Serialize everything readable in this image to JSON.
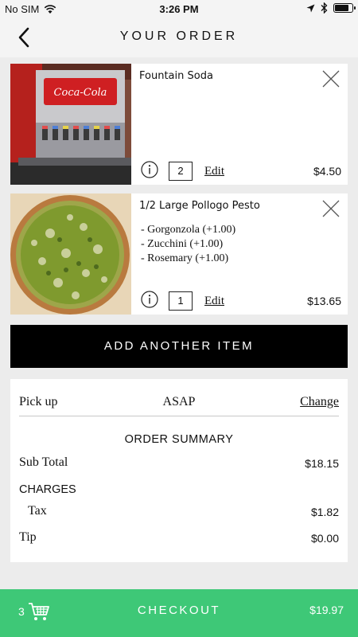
{
  "status_bar": {
    "carrier": "No SIM",
    "time": "3:26 PM",
    "battery_level": 0.9
  },
  "nav": {
    "title": "YOUR ORDER",
    "back_icon": "chevron-left-icon"
  },
  "items": [
    {
      "name": "Fountain Soda",
      "modifiers": [],
      "quantity": "2",
      "edit_label": "Edit",
      "price": "$4.50",
      "image": "fountain-soda-image"
    },
    {
      "name": "1/2 Large Pollogo Pesto",
      "modifiers": [
        "- Gorgonzola (+1.00)",
        "- Zucchini (+1.00)",
        "- Rosemary (+1.00)"
      ],
      "quantity": "1",
      "edit_label": "Edit",
      "price": "$13.65",
      "image": "pesto-pizza-image"
    }
  ],
  "add_item_label": "ADD ANOTHER ITEM",
  "pickup": {
    "label": "Pick up",
    "time": "ASAP",
    "change_label": "Change"
  },
  "summary": {
    "title": "ORDER SUMMARY",
    "subtotal_label": "Sub Total",
    "subtotal": "$18.15",
    "charges_title": "CHARGES",
    "tax_label": "Tax",
    "tax": "$1.82",
    "tip_label": "Tip",
    "tip": "$0.00"
  },
  "checkout": {
    "cart_count": "3",
    "label": "CHECKOUT",
    "total": "$19.97"
  },
  "colors": {
    "checkout_green": "#3ec877",
    "background": "#ececec",
    "button_black": "#000000"
  }
}
